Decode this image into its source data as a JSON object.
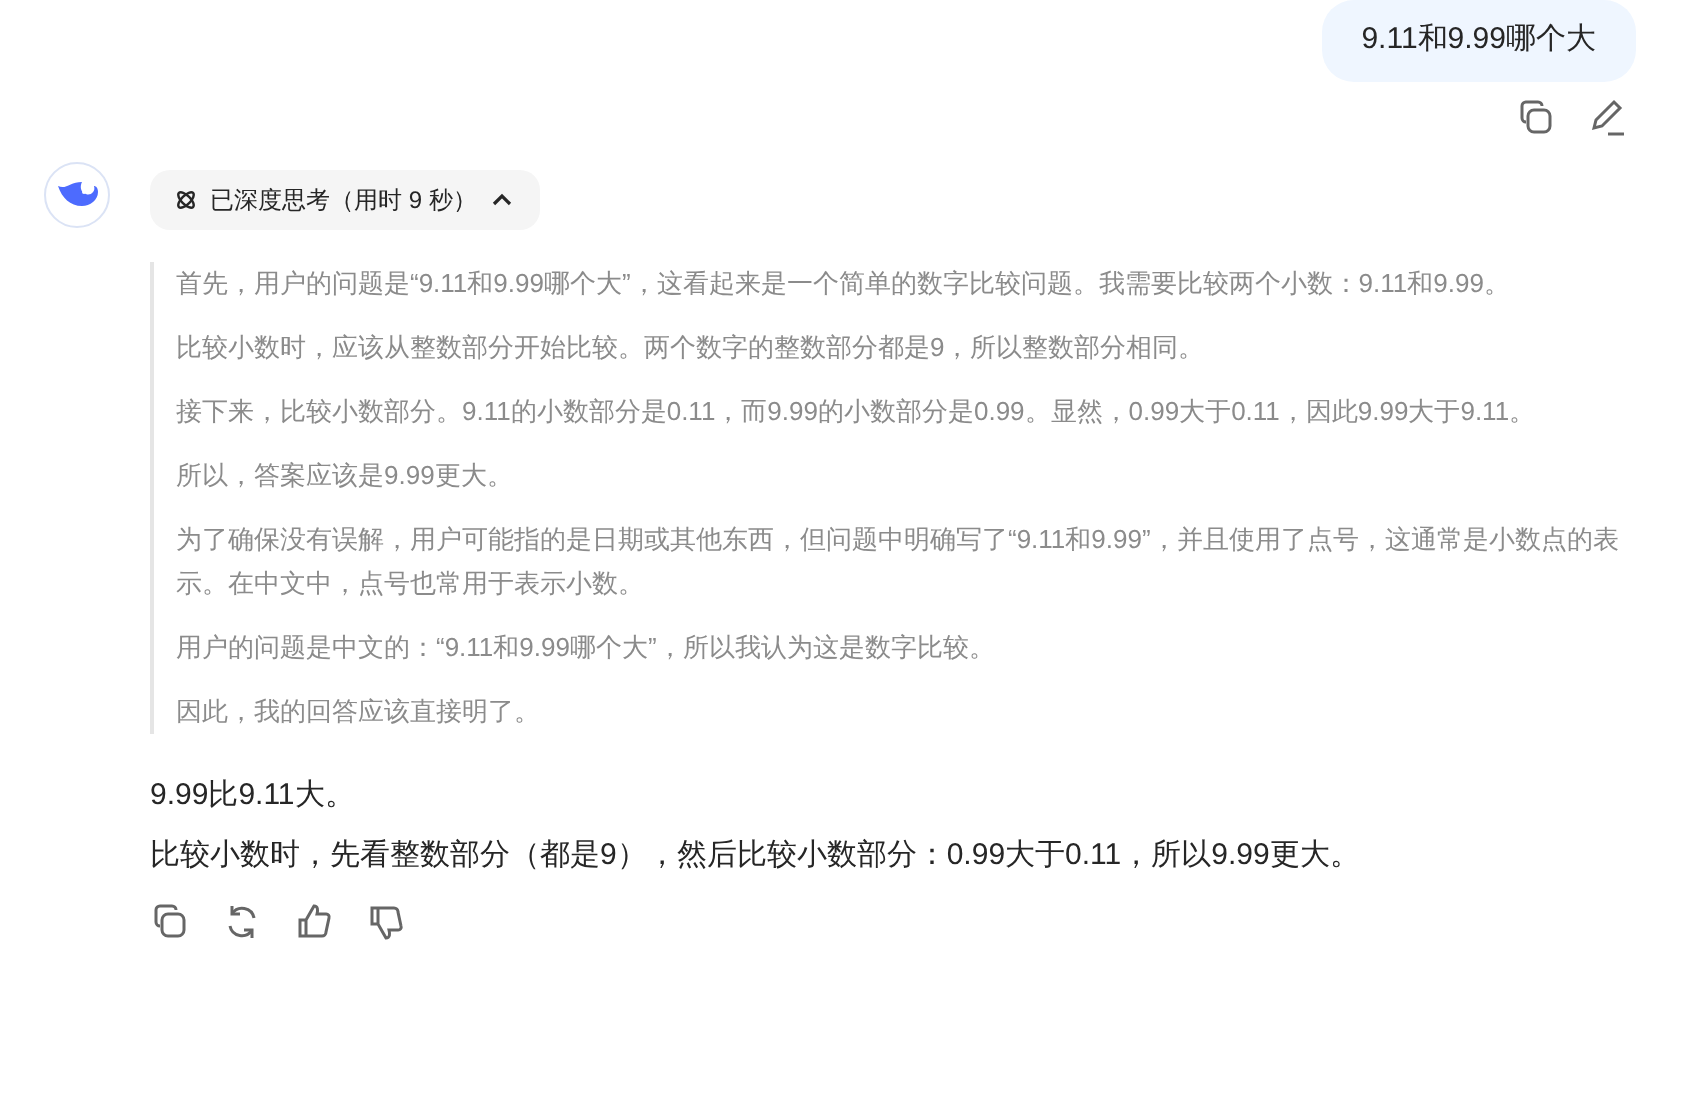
{
  "user_message": {
    "text": "9.11和9.99哪个大"
  },
  "thinking": {
    "label": "已深度思考（用时 9 秒）",
    "expanded": true,
    "paragraphs": [
      "首先，用户的问题是“9.11和9.99哪个大”，这看起来是一个简单的数字比较问题。我需要比较两个小数：9.11和9.99。",
      "比较小数时，应该从整数部分开始比较。两个数字的整数部分都是9，所以整数部分相同。",
      "接下来，比较小数部分。9.11的小数部分是0.11，而9.99的小数部分是0.99。显然，0.99大于0.11，因此9.99大于9.11。",
      "所以，答案应该是9.99更大。",
      "为了确保没有误解，用户可能指的是日期或其他东西，但问题中明确写了“9.11和9.99”，并且使用了点号，这通常是小数点的表示。在中文中，点号也常用于表示小数。",
      "用户的问题是中文的：“9.11和9.99哪个大”，所以我认为这是数字比较。",
      "因此，我的回答应该直接明了。"
    ]
  },
  "answer": {
    "lines": [
      "9.99比9.11大。",
      "比较小数时，先看整数部分（都是9），然后比较小数部分：0.99大于0.11，所以9.99更大。"
    ]
  }
}
